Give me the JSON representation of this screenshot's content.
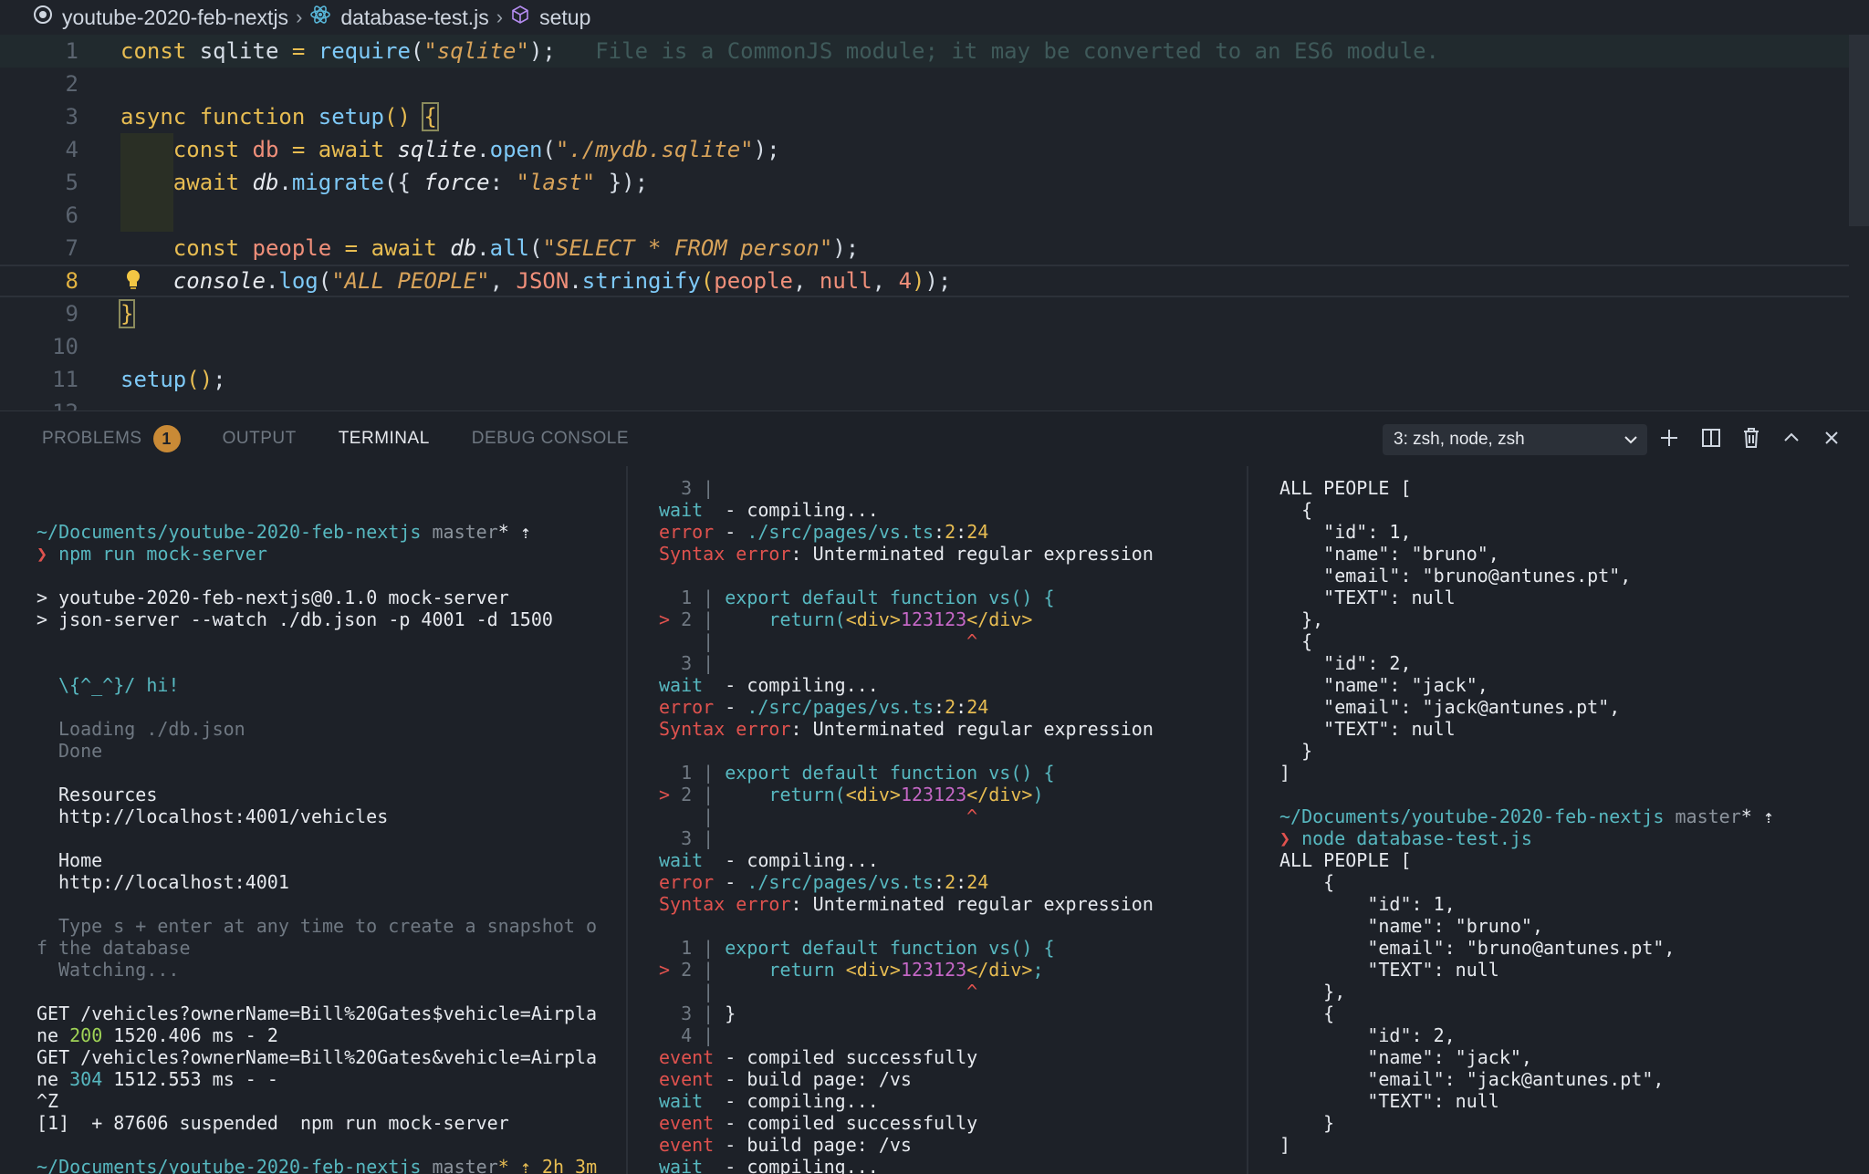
{
  "breadcrumb": {
    "project": "youtube-2020-feb-nextjs",
    "file": "database-test.js",
    "symbol": "setup"
  },
  "editor": {
    "line_numbers": [
      "1",
      "2",
      "3",
      "4",
      "5",
      "6",
      "7",
      "8",
      "9",
      "10",
      "11",
      "12"
    ],
    "active_line": "8",
    "inline_hint": "File is a CommonJS module; it may be converted to an ES6 module."
  },
  "panel": {
    "tabs": {
      "problems": "PROBLEMS",
      "problems_count": "1",
      "output": "OUTPUT",
      "terminal": "TERMINAL",
      "debug": "DEBUG CONSOLE"
    },
    "terminal_select": "3: zsh, node, zsh"
  },
  "terminal1": {
    "prompt_path": "~/Documents/youtube-2020-feb-nextjs",
    "prompt_branch": "master",
    "prompt_star": "* ⇡",
    "cmd": "npm run mock-server",
    "l1": "> youtube-2020-feb-nextjs@0.1.0 mock-server",
    "l2": "> json-server --watch ./db.json -p 4001 -d 1500",
    "hi": "\\{^_^}/ hi!",
    "loading": "Loading ./db.json",
    "done": "Done",
    "resources": "Resources",
    "res_url": "http://localhost:4001/vehicles",
    "home": "Home",
    "home_url": "http://localhost:4001",
    "hint1": "Type s + enter at any time to create a snapshot o",
    "hint2": "f the database",
    "watching": "Watching...",
    "get1a": "GET /vehicles?ownerName=Bill%20Gates$vehicle=Airpla",
    "get1b_pre": "ne ",
    "get1b_code": "200",
    "get1b_post": " 1520.406 ms - 2",
    "get2a": "GET /vehicles?ownerName=Bill%20Gates&vehicle=Airpla",
    "get2b_pre": "ne ",
    "get2b_code": "304",
    "get2b_post": " 1512.553 ms - -",
    "ctrlz": "^Z",
    "suspended": "[1]  + 87606 suspended  npm run mock-server",
    "last_prompt_path": "~/Documents/youtube-2020-feb-nextjs",
    "last_prompt_branch": "master",
    "last_prompt_extra": "* ⇡ 2h 3m"
  },
  "terminal2": {
    "lines": [
      {
        "t": "  3 |",
        "c": "c-dim"
      },
      {
        "parts": [
          [
            "wait",
            "c-cyan"
          ],
          [
            "  - compiling...",
            ""
          ]
        ]
      },
      {
        "parts": [
          [
            "error",
            "c-red"
          ],
          [
            " - ",
            ""
          ],
          [
            "./src/pages/vs.ts",
            "c-cyan"
          ],
          [
            ":",
            ""
          ],
          [
            "2",
            "c-yellow"
          ],
          [
            ":",
            ""
          ],
          [
            "24",
            "c-yellow"
          ]
        ]
      },
      {
        "parts": [
          [
            "Syntax ",
            "c-red"
          ],
          [
            "error",
            "c-red"
          ],
          [
            ": Unterminated regular expression",
            ""
          ]
        ]
      },
      {
        "t": ""
      },
      {
        "parts": [
          [
            "  1 | ",
            "c-dim"
          ],
          [
            "export default function vs() {",
            "c-blue"
          ]
        ]
      },
      {
        "parts": [
          [
            "> ",
            "c-red"
          ],
          [
            "2 | ",
            "c-dim"
          ],
          [
            "    return(",
            "c-blue"
          ],
          [
            "<div>",
            "c-jsx"
          ],
          [
            "123123",
            "c-jsxnum"
          ],
          [
            "</div>",
            "c-jsx"
          ]
        ]
      },
      {
        "parts": [
          [
            "    | ",
            "c-dim"
          ],
          [
            "                      ^",
            "c-red"
          ]
        ]
      },
      {
        "t": "  3 |",
        "c": "c-dim"
      },
      {
        "parts": [
          [
            "wait",
            "c-cyan"
          ],
          [
            "  - compiling...",
            ""
          ]
        ]
      },
      {
        "parts": [
          [
            "error",
            "c-red"
          ],
          [
            " - ",
            ""
          ],
          [
            "./src/pages/vs.ts",
            "c-cyan"
          ],
          [
            ":",
            ""
          ],
          [
            "2",
            "c-yellow"
          ],
          [
            ":",
            ""
          ],
          [
            "24",
            "c-yellow"
          ]
        ]
      },
      {
        "parts": [
          [
            "Syntax ",
            "c-red"
          ],
          [
            "error",
            "c-red"
          ],
          [
            ": Unterminated regular expression",
            ""
          ]
        ]
      },
      {
        "t": ""
      },
      {
        "parts": [
          [
            "  1 | ",
            "c-dim"
          ],
          [
            "export default function vs() {",
            "c-blue"
          ]
        ]
      },
      {
        "parts": [
          [
            "> ",
            "c-red"
          ],
          [
            "2 | ",
            "c-dim"
          ],
          [
            "    return(",
            "c-blue"
          ],
          [
            "<div>",
            "c-jsx"
          ],
          [
            "123123",
            "c-jsxnum"
          ],
          [
            "</div>",
            "c-jsx"
          ],
          [
            ")",
            "c-blue"
          ]
        ]
      },
      {
        "parts": [
          [
            "    | ",
            "c-dim"
          ],
          [
            "                      ^",
            "c-red"
          ]
        ]
      },
      {
        "t": "  3 |",
        "c": "c-dim"
      },
      {
        "parts": [
          [
            "wait",
            "c-cyan"
          ],
          [
            "  - compiling...",
            ""
          ]
        ]
      },
      {
        "parts": [
          [
            "error",
            "c-red"
          ],
          [
            " - ",
            ""
          ],
          [
            "./src/pages/vs.ts",
            "c-cyan"
          ],
          [
            ":",
            ""
          ],
          [
            "2",
            "c-yellow"
          ],
          [
            ":",
            ""
          ],
          [
            "24",
            "c-yellow"
          ]
        ]
      },
      {
        "parts": [
          [
            "Syntax ",
            "c-red"
          ],
          [
            "error",
            "c-red"
          ],
          [
            ": Unterminated regular expression",
            ""
          ]
        ]
      },
      {
        "t": ""
      },
      {
        "parts": [
          [
            "  1 | ",
            "c-dim"
          ],
          [
            "export default function vs() {",
            "c-blue"
          ]
        ]
      },
      {
        "parts": [
          [
            "> ",
            "c-red"
          ],
          [
            "2 | ",
            "c-dim"
          ],
          [
            "    return ",
            "c-blue"
          ],
          [
            "<div>",
            "c-jsx"
          ],
          [
            "123123",
            "c-jsxnum"
          ],
          [
            "</div>",
            "c-jsx"
          ],
          [
            ";",
            "c-blue"
          ]
        ]
      },
      {
        "parts": [
          [
            "    | ",
            "c-dim"
          ],
          [
            "                      ^",
            "c-red"
          ]
        ]
      },
      {
        "parts": [
          [
            "  3 | ",
            "c-dim"
          ],
          [
            "}",
            ""
          ]
        ]
      },
      {
        "t": "  4 |",
        "c": "c-dim"
      },
      {
        "parts": [
          [
            "event",
            "c-red"
          ],
          [
            " - compiled successfully",
            ""
          ]
        ]
      },
      {
        "parts": [
          [
            "event",
            "c-red"
          ],
          [
            " - build page: /vs",
            ""
          ]
        ]
      },
      {
        "parts": [
          [
            "wait",
            "c-cyan"
          ],
          [
            "  - compiling...",
            ""
          ]
        ]
      },
      {
        "parts": [
          [
            "event",
            "c-red"
          ],
          [
            " - compiled successfully",
            ""
          ]
        ]
      },
      {
        "parts": [
          [
            "event",
            "c-red"
          ],
          [
            " - build page: /vs",
            ""
          ]
        ]
      },
      {
        "parts": [
          [
            "wait",
            "c-cyan"
          ],
          [
            "  - compiling...",
            ""
          ]
        ]
      }
    ]
  },
  "terminal3": {
    "lines1": [
      "ALL PEOPLE [",
      "  {",
      "    \"id\": 1,",
      "    \"name\": \"bruno\",",
      "    \"email\": \"bruno@antunes.pt\",",
      "    \"TEXT\": null",
      "  },",
      "  {",
      "    \"id\": 2,",
      "    \"name\": \"jack\",",
      "    \"email\": \"jack@antunes.pt\",",
      "    \"TEXT\": null",
      "  }",
      "]"
    ],
    "prompt_path": "~/Documents/youtube-2020-feb-nextjs",
    "prompt_branch": "master",
    "prompt_star": "* ⇡",
    "cmd": "node database-test.js",
    "lines2": [
      "ALL PEOPLE [",
      "    {",
      "        \"id\": 1,",
      "        \"name\": \"bruno\",",
      "        \"email\": \"bruno@antunes.pt\",",
      "        \"TEXT\": null",
      "    },",
      "    {",
      "        \"id\": 2,",
      "        \"name\": \"jack\",",
      "        \"email\": \"jack@antunes.pt\",",
      "        \"TEXT\": null",
      "    }",
      "]"
    ]
  }
}
